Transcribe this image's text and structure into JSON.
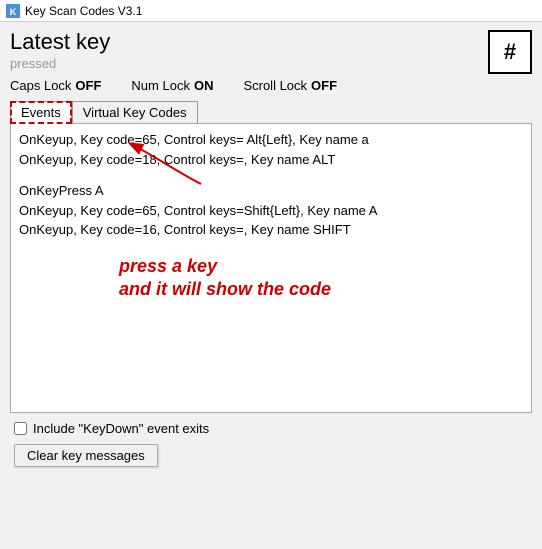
{
  "titleBar": {
    "title": "Key Scan Codes V3.1",
    "iconLabel": "K"
  },
  "latestKey": {
    "label": "Latest key",
    "sublabel": "pressed",
    "symbol": "#"
  },
  "lockStatus": {
    "capsLock": {
      "label": "Caps Lock",
      "value": "OFF"
    },
    "numLock": {
      "label": "Num Lock",
      "value": "ON"
    },
    "scrollLock": {
      "label": "Scroll Lock",
      "value": "OFF"
    }
  },
  "tabs": [
    {
      "id": "events",
      "label": "Events",
      "active": true
    },
    {
      "id": "virtual",
      "label": "Virtual Key Codes",
      "active": false
    }
  ],
  "messages": [
    "OnKeyup, Key code=65, Control keys= Alt{Left}, Key name a",
    "OnKeyup, Key code=18, Control keys=, Key name ALT",
    "",
    "OnKeyPress A",
    "OnKeyup, Key code=65, Control keys=Shift{Left}, Key name A",
    "OnKeyup, Key code=16, Control keys=, Key name SHIFT"
  ],
  "annotation": {
    "line1": "press a key",
    "line2": "and it will show the code"
  },
  "bottomSection": {
    "checkboxLabel": "Include \"KeyDown\" event exits",
    "clearButton": "Clear key messages"
  }
}
